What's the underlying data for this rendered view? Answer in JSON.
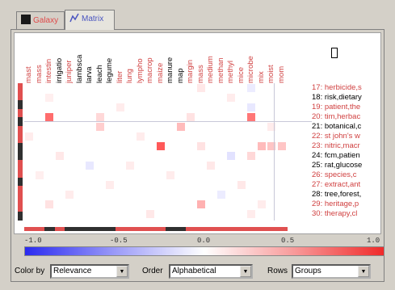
{
  "tabs": [
    {
      "label": "Galaxy",
      "icon": "galaxy-icon",
      "active": false
    },
    {
      "label": "Matrix",
      "icon": "matrix-icon",
      "active": true
    }
  ],
  "columns": [
    {
      "label": "mast",
      "color": "#d04040"
    },
    {
      "label": "mass",
      "color": "#d04040"
    },
    {
      "label": "intestin",
      "color": "#d04040"
    },
    {
      "label": "irrigatio",
      "color": "#000000"
    },
    {
      "label": "juniper",
      "color": "#d04040"
    },
    {
      "label": "lambsca",
      "color": "#000000"
    },
    {
      "label": "larva",
      "color": "#000000"
    },
    {
      "label": "leach",
      "color": "#000000"
    },
    {
      "label": "legume",
      "color": "#000000"
    },
    {
      "label": "liter",
      "color": "#d04040"
    },
    {
      "label": "lung",
      "color": "#d04040"
    },
    {
      "label": "lympho",
      "color": "#d04040"
    },
    {
      "label": "macrop",
      "color": "#d04040"
    },
    {
      "label": "maize",
      "color": "#d04040"
    },
    {
      "label": "manure",
      "color": "#000000"
    },
    {
      "label": "map",
      "color": "#000000"
    },
    {
      "label": "margin",
      "color": "#d04040"
    },
    {
      "label": "mass",
      "color": "#d04040"
    },
    {
      "label": "medium",
      "color": "#d04040"
    },
    {
      "label": "methan",
      "color": "#d04040"
    },
    {
      "label": "methyl",
      "color": "#d04040"
    },
    {
      "label": "mice",
      "color": "#d04040"
    },
    {
      "label": "microbe",
      "color": "#d04040"
    },
    {
      "label": "mix",
      "color": "#d04040"
    },
    {
      "label": "moist",
      "color": "#d04040"
    },
    {
      "label": "mom",
      "color": "#d04040"
    }
  ],
  "rows": [
    {
      "label": "17: herbicide,s",
      "color": "#d04040"
    },
    {
      "label": "18: risk,dietary",
      "color": "#000000"
    },
    {
      "label": "19: patient,the",
      "color": "#d04040"
    },
    {
      "label": "20: tim,herbac",
      "color": "#d04040"
    },
    {
      "label": "21: botanical,c",
      "color": "#000000"
    },
    {
      "label": "22: st john's w",
      "color": "#d04040"
    },
    {
      "label": "23: nitric,macr",
      "color": "#d04040"
    },
    {
      "label": "24: fcm,patien",
      "color": "#000000"
    },
    {
      "label": "25: rat,glucose",
      "color": "#000000"
    },
    {
      "label": "26: species,c",
      "color": "#d04040"
    },
    {
      "label": "27: extract,ant",
      "color": "#d04040"
    },
    {
      "label": "28: tree,forest,",
      "color": "#000000"
    },
    {
      "label": "29: heritage,p",
      "color": "#d04040"
    },
    {
      "label": "30: therapy,cl",
      "color": "#d04040"
    }
  ],
  "row_group_bar": [
    "#e05050",
    "#e05050",
    "#303030",
    "#e05050",
    "#303030",
    "#e05050",
    "#e05050",
    "#303030",
    "#303030",
    "#e05050",
    "#e05050",
    "#303030",
    "#e05050",
    "#e05050",
    "#e05050",
    "#303030"
  ],
  "col_group_bar": [
    "#e05050",
    "#e05050",
    "#303030",
    "#e05050",
    "#303030",
    "#303030",
    "#303030",
    "#303030",
    "#303030",
    "#e05050",
    "#e05050",
    "#e05050",
    "#e05050",
    "#e05050",
    "#303030",
    "#303030",
    "#e05050",
    "#e05050",
    "#e05050",
    "#e05050",
    "#e05050",
    "#e05050",
    "#e05050",
    "#e05050",
    "#e05050",
    "#e05050"
  ],
  "cells": [
    {
      "r": 0,
      "c": 17,
      "v": 0.12
    },
    {
      "r": 0,
      "c": 22,
      "v": -0.1
    },
    {
      "r": 1,
      "c": 2,
      "v": 0.08
    },
    {
      "r": 1,
      "c": 20,
      "v": 0.1
    },
    {
      "r": 2,
      "c": 9,
      "v": 0.1
    },
    {
      "r": 2,
      "c": 22,
      "v": -0.12
    },
    {
      "r": 3,
      "c": 2,
      "v": 0.75
    },
    {
      "r": 3,
      "c": 7,
      "v": 0.2
    },
    {
      "r": 3,
      "c": 16,
      "v": 0.15
    },
    {
      "r": 3,
      "c": 22,
      "v": 0.7
    },
    {
      "r": 4,
      "c": 7,
      "v": 0.25
    },
    {
      "r": 4,
      "c": 15,
      "v": 0.35
    },
    {
      "r": 4,
      "c": 24,
      "v": 0.1
    },
    {
      "r": 5,
      "c": 0,
      "v": 0.1
    },
    {
      "r": 5,
      "c": 11,
      "v": 0.1
    },
    {
      "r": 6,
      "c": 13,
      "v": 0.85
    },
    {
      "r": 6,
      "c": 17,
      "v": 0.15
    },
    {
      "r": 6,
      "c": 23,
      "v": 0.35
    },
    {
      "r": 6,
      "c": 24,
      "v": 0.3
    },
    {
      "r": 6,
      "c": 25,
      "v": 0.3
    },
    {
      "r": 7,
      "c": 3,
      "v": 0.12
    },
    {
      "r": 7,
      "c": 20,
      "v": -0.15
    },
    {
      "r": 7,
      "c": 22,
      "v": 0.2
    },
    {
      "r": 8,
      "c": 6,
      "v": -0.12
    },
    {
      "r": 8,
      "c": 10,
      "v": 0.1
    },
    {
      "r": 8,
      "c": 18,
      "v": 0.12
    },
    {
      "r": 9,
      "c": 1,
      "v": 0.08
    },
    {
      "r": 9,
      "c": 14,
      "v": 0.1
    },
    {
      "r": 10,
      "c": 8,
      "v": 0.1
    },
    {
      "r": 10,
      "c": 21,
      "v": 0.12
    },
    {
      "r": 11,
      "c": 4,
      "v": 0.1
    },
    {
      "r": 11,
      "c": 19,
      "v": -0.1
    },
    {
      "r": 12,
      "c": 2,
      "v": 0.15
    },
    {
      "r": 12,
      "c": 17,
      "v": 0.4
    },
    {
      "r": 12,
      "c": 23,
      "v": 0.1
    },
    {
      "r": 13,
      "c": 12,
      "v": 0.12
    },
    {
      "r": 13,
      "c": 22,
      "v": 0.1
    }
  ],
  "legend": {
    "ticks": [
      "-1.0",
      "-0.5",
      "0.0",
      "0.5",
      "1.0"
    ]
  },
  "controls": {
    "color_by_label": "Color by",
    "color_by_value": "Relevance",
    "order_label": "Order",
    "order_value": "Alphabetical",
    "rows_label": "Rows",
    "rows_value": "Groups"
  }
}
